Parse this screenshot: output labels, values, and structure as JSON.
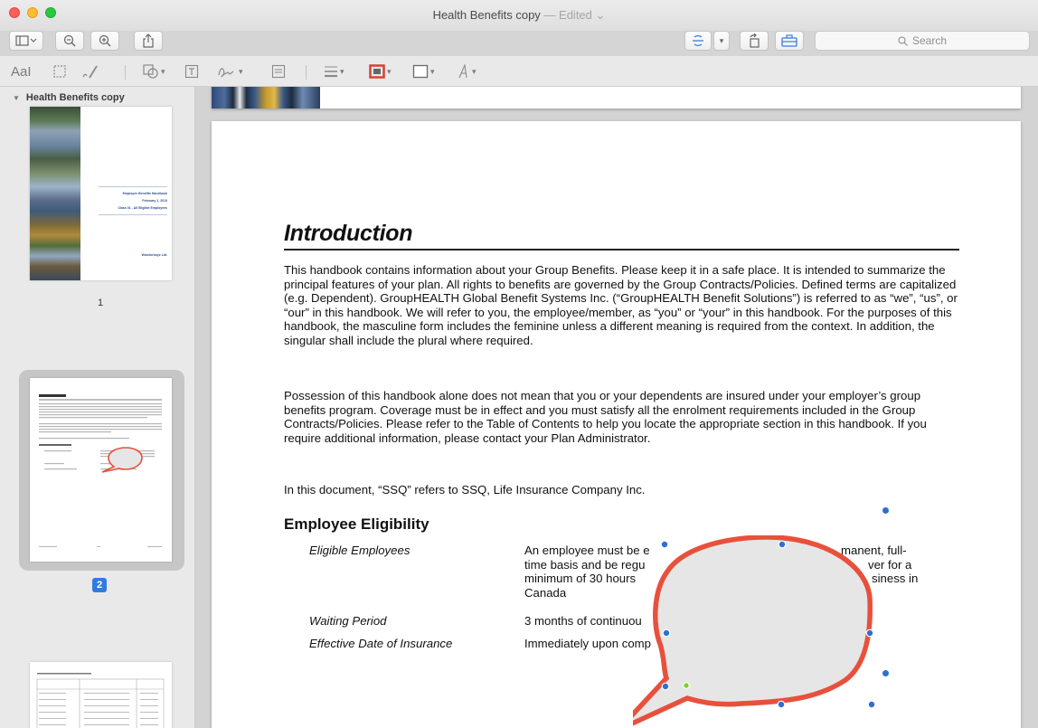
{
  "window": {
    "title": "Health Benefits copy",
    "edited_label": "— Edited"
  },
  "toolbar": {
    "search_placeholder": "Search"
  },
  "markup_toolbar": {
    "text_style_label": "AaI"
  },
  "sidebar": {
    "document_name": "Health Benefits copy",
    "pages": [
      {
        "number": "1"
      },
      {
        "number": "2",
        "selected": true
      }
    ],
    "cover_lines": [
      "Employee Benefits Handbook",
      "February 1, 2013",
      "Class 01 - All Eligible Employees",
      "Wonderboyz Ltd."
    ]
  },
  "document": {
    "heading": "Introduction",
    "paragraph1": "This handbook contains information about your Group Benefits.  Please keep it in a safe place.  It is intended to summarize the principal features of your plan.  All rights to benefits are governed by the Group Contracts/Policies. Defined terms are capitalized (e.g. Dependent).  GroupHEALTH Global Benefit Systems Inc. (“GroupHEALTH Benefit Solutions”) is referred to as “we”, “us”, or “our” in this handbook.  We will refer to you, the employee/member, as “you” or “your” in this handbook.  For the purposes of this handbook, the masculine form includes the feminine unless a different meaning is required from the context.  In addition, the singular shall include the plural where required.",
    "paragraph2": "Possession of this handbook alone does not mean that you or your dependents are insured under your employer’s group benefits program.  Coverage must be in effect and you must satisfy all the enrolment requirements included in the Group Contracts/Policies.  Please refer to the Table of Contents to help you locate the appropriate section in this handbook.  If you require additional information, please contact your Plan Administrator.",
    "paragraph3": "In this document, “SSQ” refers to SSQ, Life Insurance Company Inc.",
    "eligibility_heading": "Employee Eligibility",
    "eligibility_rows": [
      {
        "label": "Eligible Employees",
        "line1": "An employee must be e",
        "line1_tail": "manent, full-",
        "line2": "time basis and be regu",
        "line2_tail": "ver for a",
        "line3": "minimum of 30 hours",
        "line3_tail": "siness in",
        "line4": "Canada"
      },
      {
        "label": "Waiting Period",
        "value": "3 months of continuou"
      },
      {
        "label": "Effective Date of Insurance",
        "value": "Immediately upon comp"
      }
    ]
  },
  "colors": {
    "bubble_stroke": "#e8503c",
    "bubble_fill": "#e6e6e6",
    "handle": "#2f6fd0",
    "selected_page": "#2f7be0"
  }
}
